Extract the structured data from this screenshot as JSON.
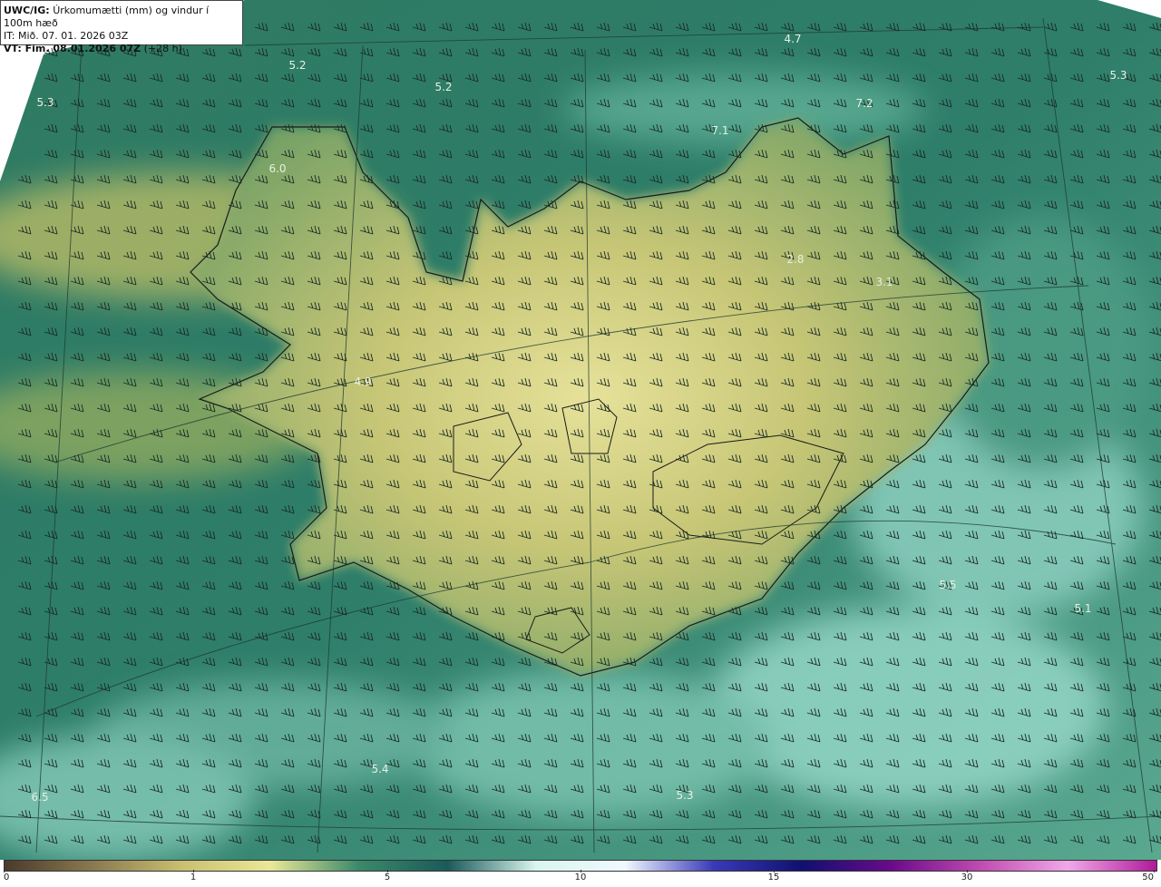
{
  "header": {
    "model": "UWC/IG:",
    "title": "Úrkomumætti (mm) og vindur í 100m hæð",
    "it": "IT: Mið. 07. 01. 2026 03Z",
    "vt": "VT: Fim. 08.01.2026 07Z",
    "lead": "(+28 h)"
  },
  "map_labels": [
    "5.3",
    "5.2",
    "5.2",
    "4.7",
    "5.3",
    "7.2",
    "7.1",
    "6.0",
    "2.8",
    "3.1",
    "4.9",
    "5.5",
    "5.1",
    "5.4",
    "5.3",
    "6.5"
  ],
  "colorbar": {
    "ticks": [
      "0",
      "1",
      "5",
      "10",
      "15",
      "30",
      "50"
    ],
    "colors": [
      "#4a3a2c",
      "#8a7a50",
      "#c8c070",
      "#eae898",
      "#3a8a6a",
      "#1a5a5a",
      "#d8f6ee",
      "#f0f8ff",
      "#3a3ab8",
      "#101070",
      "#6a0a8a",
      "#c04ab0",
      "#f0a8e8",
      "#b01a9a"
    ]
  }
}
